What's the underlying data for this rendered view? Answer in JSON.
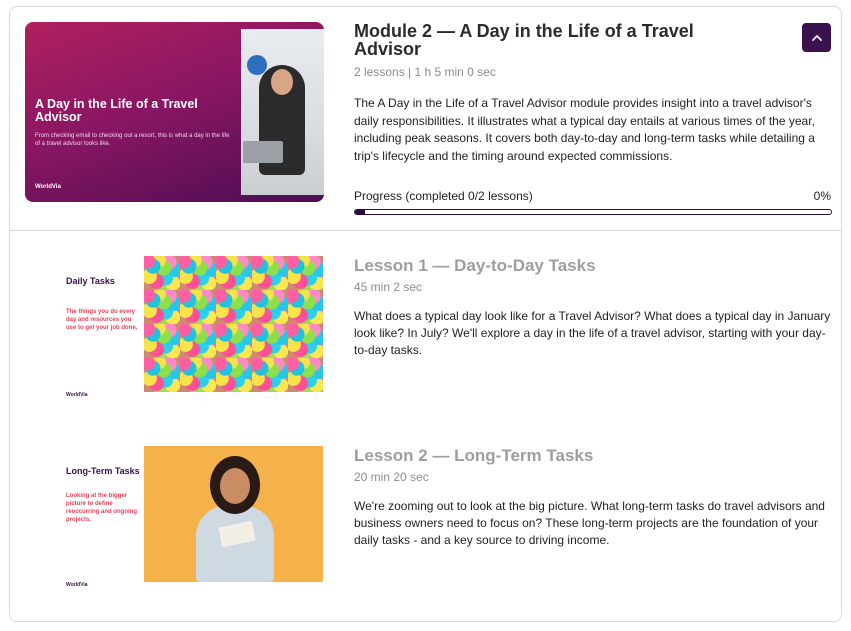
{
  "module": {
    "title": "Module 2 — A Day in the Life of a Travel Advisor",
    "meta": "2 lessons | 1 h 5 min 0 sec",
    "description": "The A Day in the Life of a Travel Advisor module provides insight into a travel advisor's daily responsibilities. It illustrates what a typical day entails at various times of the year, including peak seasons. It covers both day-to-day and long-term tasks while detailing a trip's lifecycle and the timing around expected commissions.",
    "progress_label": "Progress (completed 0/2 lessons)",
    "progress_percent": "0%",
    "progress_value": 0,
    "thumbnail": {
      "title": "A Day in the Life of a Travel Advisor",
      "subtitle": "From checking email to checking out a resort, this is what a day in the life of a travel advisor looks like.",
      "brand": "WorldVia"
    }
  },
  "lessons": [
    {
      "title": "Lesson 1 — Day-to-Day Tasks",
      "meta": "45 min 2 sec",
      "description": "What does a typical day look like for a Travel Advisor? What does a typical day in January look like? In July? We'll explore a day in the life of a travel advisor, starting with your day-to-day tasks.",
      "thumbnail": {
        "title": "Daily Tasks",
        "subtitle": "The things you do every day and resources you use to get your job done.",
        "brand": "WorldVia"
      }
    },
    {
      "title": "Lesson 2 — Long-Term Tasks",
      "meta": "20 min 20 sec",
      "description": "We're zooming out to look at the big picture. What long-term tasks do travel advisors and business owners need to focus on? These long-term projects are the foundation of your daily tasks - and a key source to driving income.",
      "thumbnail": {
        "title": "Long-Term Tasks",
        "subtitle": "Looking at the bigger picture to define reoccurring and ongoing projects.",
        "brand": "WorldVia"
      }
    }
  ],
  "icons": {
    "collapse": "chevron-up-icon"
  },
  "colors": {
    "accent": "#3b1150",
    "lesson_title": "#9e9e9e"
  }
}
